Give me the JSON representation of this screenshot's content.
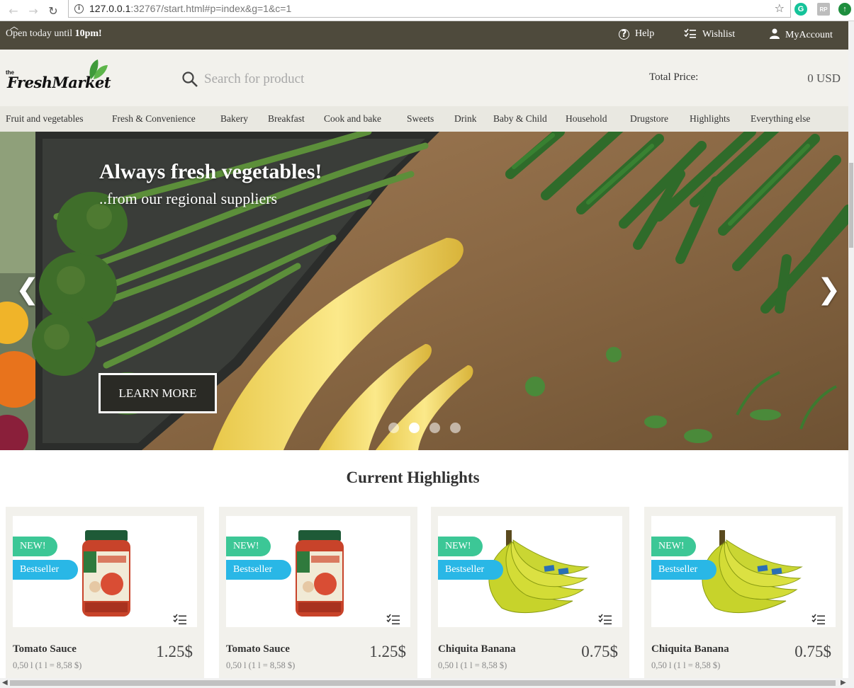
{
  "browser": {
    "url_host": "127.0.0.1",
    "url_rest": ":32767/start.html#p=index&g=1&c=1"
  },
  "topbar": {
    "open_prefix": "Open today until ",
    "open_time": "10pm!",
    "help_label": "Help",
    "wishlist_label": "Wishlist",
    "account_label": "MyAccount"
  },
  "header": {
    "logo_the": "the",
    "logo_name": "FreshMarket",
    "search_placeholder": "Search for product",
    "total_label": "Total Price:",
    "total_value": "0 USD"
  },
  "categories": [
    "Fruit and vegetables",
    "Fresh & Convenience",
    "Bakery",
    "Breakfast",
    "Cook and bake",
    "Sweets",
    "Drink",
    "Baby & Child",
    "Household",
    "Drugstore",
    "Highlights",
    "Everything else"
  ],
  "hero": {
    "headline": "Always fresh vegetables!",
    "subline": "..from our regional suppliers",
    "button_label": "LEARN MORE",
    "prev_arrow": "❮",
    "next_arrow": "❯",
    "slide_count": 4,
    "active_slide": 2
  },
  "highlights": {
    "title": "Current Highlights",
    "products": [
      {
        "name": "Tomato Sauce",
        "price": "1.25$",
        "size": "0,50 l (1 l = 8,58 $)",
        "badge_new": "NEW!",
        "badge_best": "Bestseller",
        "image": "tomato-sauce-jar"
      },
      {
        "name": "Tomato Sauce",
        "price": "1.25$",
        "size": "0,50 l (1 l = 8,58 $)",
        "badge_new": "NEW!",
        "badge_best": "Bestseller",
        "image": "tomato-sauce-jar"
      },
      {
        "name": "Chiquita Banana",
        "price": "0.75$",
        "size": "0,50 l (1 l = 8,58 $)",
        "badge_new": "NEW!",
        "badge_best": "Bestseller",
        "image": "banana-bunch"
      },
      {
        "name": "Chiquita Banana",
        "price": "0.75$",
        "size": "0,50 l (1 l = 8,58 $)",
        "badge_new": "NEW!",
        "badge_best": "Bestseller",
        "image": "banana-bunch"
      }
    ]
  },
  "colors": {
    "topbar": "#4e4a3c",
    "header": "#f2f1ec",
    "catnav": "#e9e8e1",
    "badge_new": "#3cc796",
    "badge_best": "#29b7e6"
  }
}
